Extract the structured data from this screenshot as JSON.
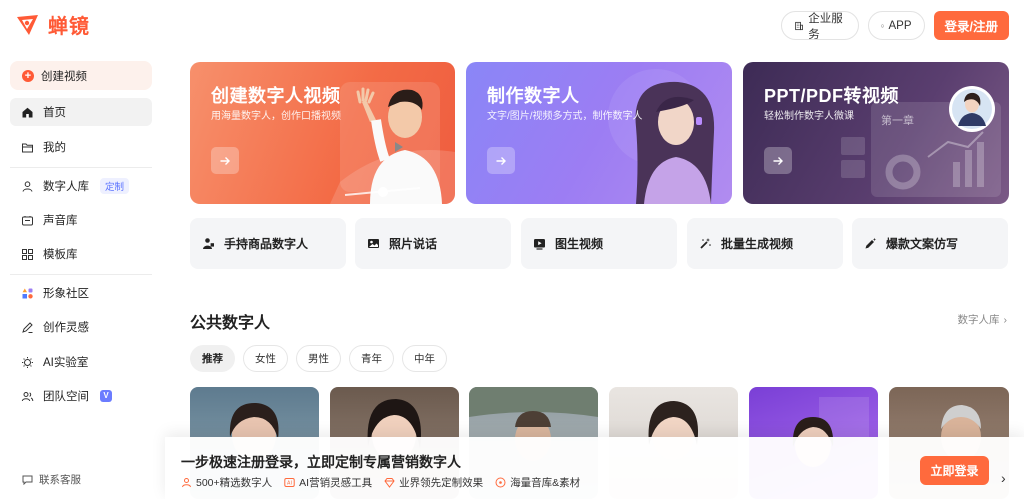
{
  "app": {
    "logo_text": "蝉镜",
    "brand_color": "#ff5a36"
  },
  "header": {
    "enterprise_label": "企业服务",
    "app_label": "APP",
    "login_label": "登录/注册"
  },
  "sidebar": {
    "create_label": "创建视频",
    "items": [
      {
        "label": "首页",
        "icon": "home-icon"
      },
      {
        "label": "我的",
        "icon": "folder-icon"
      },
      {
        "label": "数字人库",
        "icon": "person-icon",
        "badge": "定制"
      },
      {
        "label": "声音库",
        "icon": "audio-box-icon"
      },
      {
        "label": "模板库",
        "icon": "grid-icon"
      },
      {
        "label": "形象社区",
        "icon": "shapes-icon"
      },
      {
        "label": "创作灵感",
        "icon": "pen-icon"
      },
      {
        "label": "AI实验室",
        "icon": "bulb-icon"
      },
      {
        "label": "团队空间",
        "icon": "team-icon",
        "badge": "V"
      }
    ],
    "support_label": "联系客服"
  },
  "banners": [
    {
      "title": "创建数字人视频",
      "subtitle": "用海量数字人，创作口播视频"
    },
    {
      "title": "制作数字人",
      "subtitle": "文字/图片/视频多方式，制作数字人"
    },
    {
      "title": "PPT/PDF转视频",
      "subtitle": "轻松制作数字人微课",
      "slide_label": "第一章"
    }
  ],
  "quick_actions": [
    {
      "label": "手持商品数字人",
      "icon": "person-product-icon"
    },
    {
      "label": "照片说话",
      "icon": "photo-icon"
    },
    {
      "label": "图生视频",
      "icon": "video-play-icon"
    },
    {
      "label": "批量生成视频",
      "icon": "magic-wand-icon"
    },
    {
      "label": "爆款文案仿写",
      "icon": "pen-sparkle-icon"
    }
  ],
  "section": {
    "title": "公共数字人",
    "more_label": "数字人库"
  },
  "filters": [
    "推荐",
    "女性",
    "男性",
    "青年",
    "中年"
  ],
  "promo": {
    "title": "一步极速注册登录，立即定制专属营销数字人",
    "features": [
      {
        "label": "500+精选数字人",
        "icon": "person-outline-icon"
      },
      {
        "label": "AI营销灵感工具",
        "icon": "ai-icon"
      },
      {
        "label": "业界领先定制效果",
        "icon": "diamond-icon"
      },
      {
        "label": "海量音库&素材",
        "icon": "music-icon"
      }
    ],
    "cta_label": "立即登录"
  }
}
